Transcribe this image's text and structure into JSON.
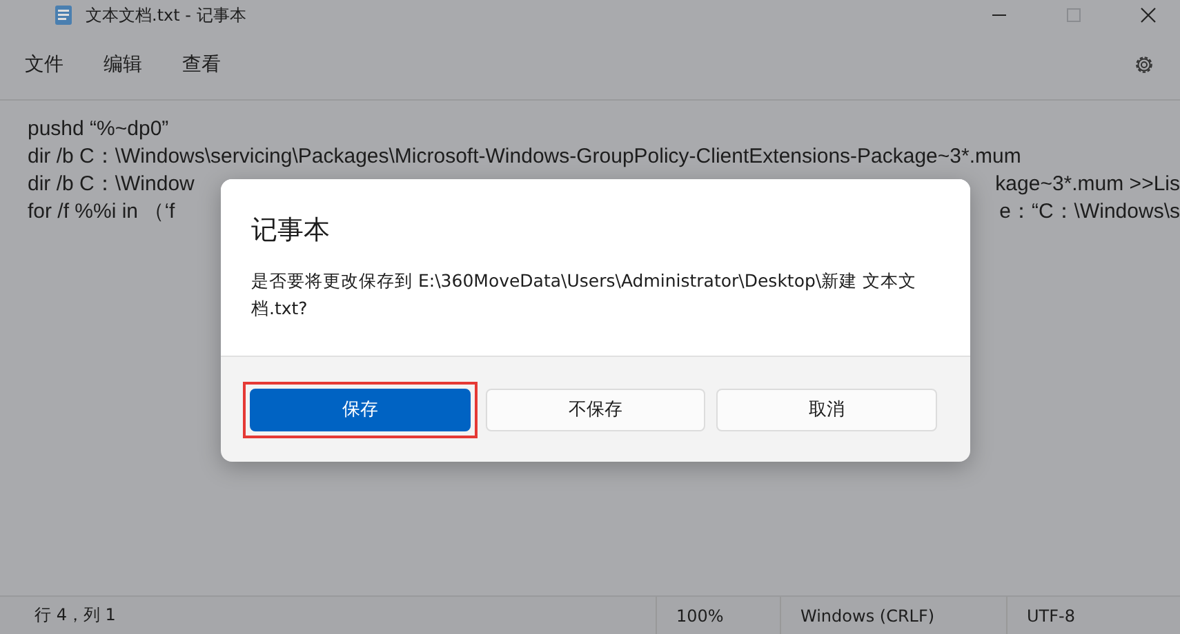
{
  "window": {
    "title": "文本文档.txt - 记事本"
  },
  "menu": [
    "文件",
    "编辑",
    "查看"
  ],
  "editor": {
    "lines": [
      {
        "left": "pushd “%~dp0”"
      },
      {
        "left": "dir /b C：\\Windows\\servicing\\Packages\\Microsoft-Windows-GroupPolicy-ClientExtensions-Package~3*.mum"
      },
      {
        "left": "dir /b C：\\Window",
        "right": "kage~3*.mum >>Lis"
      },
      {
        "left": "for /f %%i in （‘f",
        "right": "e：“C：\\Windows\\s"
      }
    ]
  },
  "dialog": {
    "title": "记事本",
    "message": "是否要将更改保存到 E:\\360MoveData\\Users\\Administrator\\Desktop\\新建 文本文档.txt?",
    "buttons": [
      {
        "label": "保存",
        "primary": true,
        "highlighted": true
      },
      {
        "label": "不保存",
        "primary": false,
        "highlighted": false
      },
      {
        "label": "取消",
        "primary": false,
        "highlighted": false
      }
    ]
  },
  "status_bar": {
    "position": "行 4，列 1",
    "zoom": "100%",
    "line_ending": "Windows (CRLF)",
    "encoding": "UTF-8"
  }
}
